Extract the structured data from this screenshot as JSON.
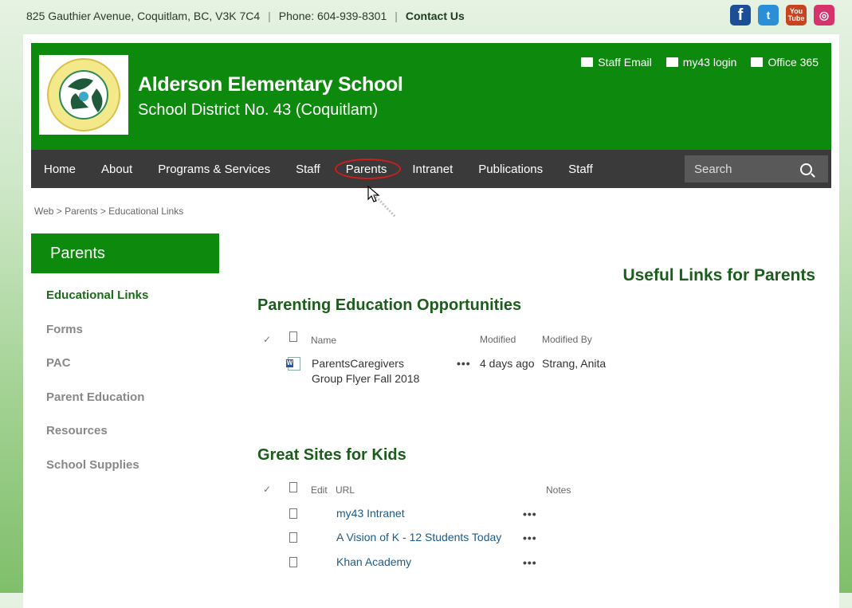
{
  "topbar": {
    "address": "825 Gauthier Avenue, Coquitlam, BC, V3K 7C4",
    "separator": "|",
    "phone": "Phone: 604-939-8301",
    "contact": "Contact Us",
    "social": [
      {
        "icon": "facebook-icon",
        "glyph": "f"
      },
      {
        "icon": "twitter-icon",
        "glyph": "t"
      },
      {
        "icon": "youtube-icon",
        "glyph": "You Tube"
      },
      {
        "icon": "instagram-icon",
        "glyph": "◎"
      }
    ]
  },
  "header": {
    "school_name": "Alderson Elementary School",
    "district": "School District No. 43 (Coquitlam)",
    "links": {
      "staff_email": "Staff Email",
      "my43_login": "my43 login",
      "office365": "Office 365"
    }
  },
  "nav": {
    "items": [
      "Home",
      "About",
      "Programs & Services",
      "Staff",
      "Parents",
      "Intranet",
      "Publications",
      "Staff"
    ],
    "active_index": 4,
    "search_placeholder": "Search"
  },
  "breadcrumb": "Web > Parents > Educational Links",
  "sidebar": {
    "heading": "Parents",
    "items": [
      "Educational Links",
      "Forms",
      "PAC",
      "Parent Education",
      "Resources",
      "School Supplies"
    ],
    "current_index": 0
  },
  "main": {
    "page_title": "Useful Links for Parents",
    "section1": {
      "title": "Parenting Education Opportunities",
      "headers": {
        "name": "Name",
        "modified": "Modified",
        "modified_by": "Modified By"
      },
      "rows": [
        {
          "name_line1": "ParentsCaregivers",
          "name_line2": "Group Flyer Fall 2018",
          "modified": "4 days ago",
          "modified_by": "Strang, Anita"
        }
      ]
    },
    "section2": {
      "title": "Great Sites for Kids",
      "headers": {
        "edit": "Edit",
        "url": "URL",
        "notes": "Notes"
      },
      "rows": [
        {
          "url": "my43 Intranet"
        },
        {
          "url": "A Vision of K - 12 Students Today"
        },
        {
          "url": "Khan Academy"
        }
      ]
    },
    "ellipsis": "•••",
    "check": "✓"
  },
  "colors": {
    "brand_green": "#0d8a0d",
    "nav_bg": "#3a3a3a",
    "heading_green": "#1c5c1c",
    "link_blue": "#1e5a8a"
  }
}
